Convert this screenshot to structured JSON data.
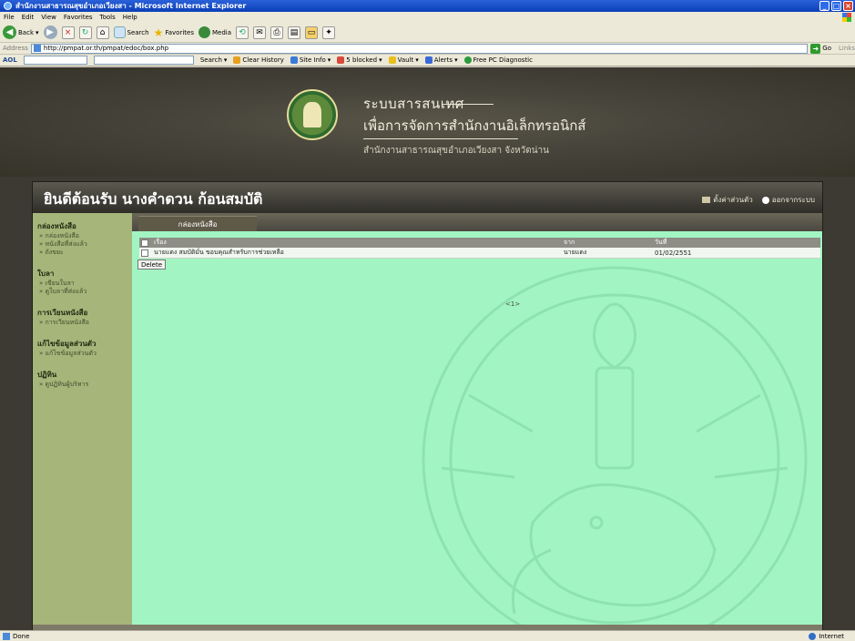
{
  "window": {
    "title": "สำนักงานสาธารณสุขอำเภอเวียงสา - Microsoft Internet Explorer"
  },
  "menu": [
    "File",
    "Edit",
    "View",
    "Favorites",
    "Tools",
    "Help"
  ],
  "toolbar": {
    "back": "Back",
    "search": "Search",
    "favorites": "Favorites",
    "media": "Media"
  },
  "address": {
    "label": "Address",
    "url": "http://pmpat.or.th/pmpat/edoc/box.php",
    "go": "Go",
    "links": "Links"
  },
  "aol": {
    "logo": "AOL",
    "search_label": "Search",
    "clear_history": "Clear History",
    "site_info": "Site Info",
    "blocked": "5 blocked",
    "vault": "Vault",
    "alerts": "Alerts",
    "diagnostic": "Free PC Diagnostic"
  },
  "banner": {
    "line1": "ระบบสารสนเทศ",
    "line2": "เพื่อการจัดการสำนักงานอิเล็กทรอนิกส์",
    "line3": "สำนักงานสาธารณสุขอำเภอเวียงสา จังหวัดน่าน"
  },
  "welcome": {
    "text": "ยินดีต้อนรับ นางคำดวน ก้อนสมบัติ",
    "link1": "ตั้งค่าส่วนตัว",
    "link2": "ออกจากระบบ"
  },
  "sidebar": {
    "sections": [
      {
        "title": "กล่องหนังสือ",
        "items": [
          "กล่องหนังสือ",
          "หนังสือที่ส่งแล้ว",
          "ถังขยะ"
        ]
      },
      {
        "title": "ใบลา",
        "items": [
          "เขียนใบลา",
          "ดูใบลาที่ส่งแล้ว"
        ]
      },
      {
        "title": "การเวียนหนังสือ",
        "items": [
          "การเวียนหนังสือ"
        ]
      },
      {
        "title": "แก้ไขข้อมูลส่วนตัว",
        "items": [
          "แก้ไขข้อมูลส่วนตัว"
        ]
      },
      {
        "title": "ปฏิทิน",
        "items": [
          "ดูปฏิทินผู้บริหาร"
        ]
      }
    ]
  },
  "main": {
    "tab": "กล่องหนังสือ",
    "columns": [
      "เรื่อง",
      "จาก",
      "วันที่"
    ],
    "rows": [
      {
        "subject": "นายแดง สมบัติมั่น ขอบคุณสำหรับการช่วยเหลือ",
        "from": "นายแดง",
        "date": "01/02/2551"
      }
    ],
    "delete_label": "Delete",
    "pager": "<1>"
  },
  "status": {
    "left": "Done",
    "zone": "Internet"
  }
}
